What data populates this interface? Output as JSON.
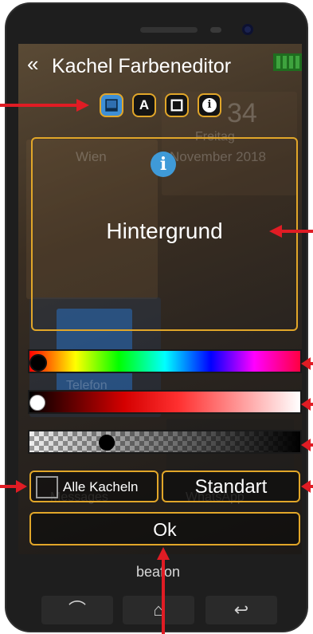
{
  "header": {
    "title": "Kachel Farbeneditor",
    "back_glyph": "«"
  },
  "mode_buttons": [
    {
      "name": "background-mode",
      "glyph": "",
      "icon": "background-swatch-icon",
      "active": true
    },
    {
      "name": "text-mode",
      "glyph": "A",
      "icon": "letter-a-icon",
      "active": false
    },
    {
      "name": "border-mode",
      "glyph": "",
      "icon": "square-outline-icon",
      "active": false
    },
    {
      "name": "info-mode",
      "glyph": "i",
      "icon": "info-icon",
      "active": false
    }
  ],
  "preview": {
    "info_glyph": "i",
    "label": "Hintergrund"
  },
  "background_tiles": {
    "time": "34",
    "weekday": "Freitag",
    "date": "November 2018",
    "city": "Wien",
    "phone_label": "Telefon",
    "messages_label": "Messages",
    "whatsapp_label": "WhatsApp"
  },
  "sliders": {
    "hue_level": 0.0,
    "saturation_level": 0.0,
    "alpha_level": 0.27
  },
  "buttons": {
    "all_tiles": "Alle Kacheln",
    "all_tiles_checked": false,
    "default": "Standart",
    "ok": "Ok"
  },
  "device": {
    "brand": "beafon",
    "nav_back": "⌒",
    "nav_home": "⌂",
    "nav_return": "↩"
  },
  "colors": {
    "accent": "#e1a629",
    "annotation": "#e01c24",
    "info_blue": "#3f9ad8"
  }
}
